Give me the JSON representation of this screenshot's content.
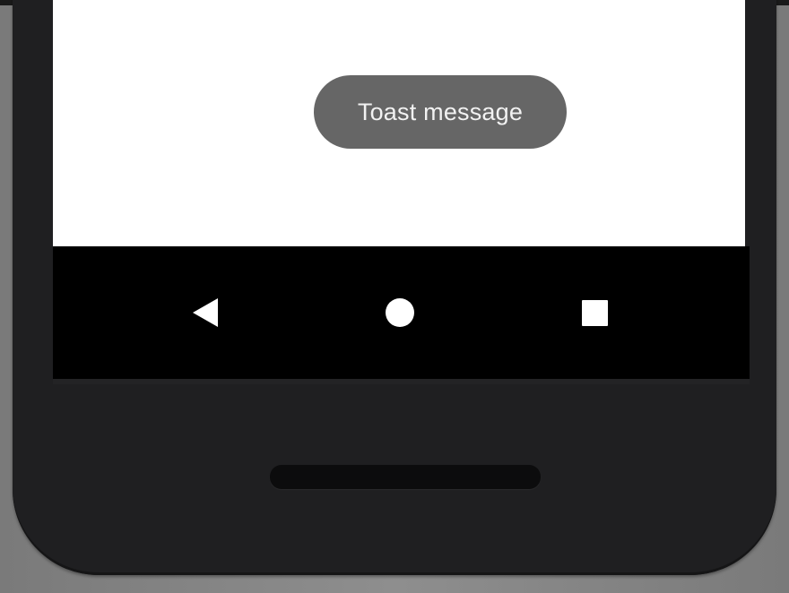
{
  "toast": {
    "message": "Toast message"
  },
  "navigation_bar": {
    "buttons": [
      {
        "name": "back",
        "icon": "back-triangle-icon"
      },
      {
        "name": "home",
        "icon": "home-circle-icon"
      },
      {
        "name": "recents",
        "icon": "recents-square-icon"
      }
    ]
  },
  "colors": {
    "screen_background": "#ffffff",
    "toast_background": "#666666",
    "toast_text": "#f2f2f2",
    "navbar_background": "#000000",
    "nav_icon": "#ffffff",
    "device_body": "#1f1f21"
  }
}
